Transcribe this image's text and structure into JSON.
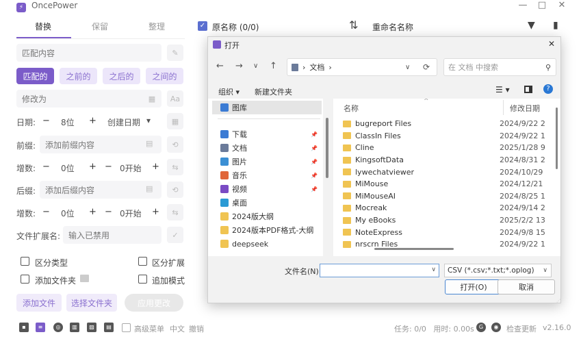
{
  "app": {
    "title": "OncePower",
    "win_min": "—",
    "win_max": "□",
    "win_close": "✕"
  },
  "tabs": [
    {
      "label": "替换"
    },
    {
      "label": "保留"
    },
    {
      "label": "整理"
    }
  ],
  "replace": {
    "match_placeholder": "匹配内容",
    "modes": [
      "匹配的",
      "之前的",
      "之后的",
      "之间的"
    ],
    "change_placeholder": "修改为",
    "aa": "Aa"
  },
  "date_row": {
    "label": "日期:",
    "minus": "−",
    "value": "8位",
    "plus": "+",
    "type": "创建日期",
    "caret": "▾"
  },
  "prefix": {
    "label": "前缀:",
    "placeholder": "添加前缀内容"
  },
  "incr1": {
    "label": "增数:",
    "minus": "−",
    "value": "0位",
    "plus": "+",
    "minus2": "−",
    "start": "0开始",
    "plus2": "+"
  },
  "suffix": {
    "label": "后缀:",
    "placeholder": "添加后缀内容"
  },
  "incr2": {
    "label": "增数:",
    "minus": "−",
    "value": "0位",
    "plus": "+",
    "minus2": "−",
    "start": "0开始",
    "plus2": "+"
  },
  "ext": {
    "label": "文件扩展名:",
    "placeholder": "输入已禁用"
  },
  "options": {
    "case_type": "区分类型",
    "case_ext": "区分扩展",
    "add_folder": "添加文件夹",
    "append_mode": "追加模式"
  },
  "actions": {
    "add_file": "添加文件",
    "select_folder": "选择文件夹",
    "apply": "应用更改"
  },
  "bottom": {
    "advanced": "高级菜单",
    "lang": "中文",
    "undo": "撤销",
    "status": "任务: 0/0   用时: 0.00s",
    "update": "检查更新",
    "version": "v2.16.0"
  },
  "header": {
    "original_name": "原名称 (0/0)",
    "rename_name": "重命名名称"
  },
  "dialog": {
    "title": "打开",
    "close": "✕",
    "path_sep": "›",
    "path": "文档",
    "search_placeholder": "在 文档 中搜索",
    "organize": "组织 ▾",
    "new_folder": "新建文件夹",
    "sidebar": [
      {
        "label": "图库",
        "color": "#3b7bd4",
        "pinned": false,
        "sel": true
      },
      {
        "label": "下载",
        "color": "#3b7bd4",
        "pinned": true
      },
      {
        "label": "文档",
        "color": "#6b7b9a",
        "pinned": true
      },
      {
        "label": "图片",
        "color": "#3b8fd4",
        "pinned": true
      },
      {
        "label": "音乐",
        "color": "#e0663a",
        "pinned": true
      },
      {
        "label": "视频",
        "color": "#7a4bc4",
        "pinned": true
      },
      {
        "label": "桌面",
        "color": "#2a9ad4",
        "pinned": false
      },
      {
        "label": "2024版大纲",
        "color": "#f0c452",
        "pinned": false
      },
      {
        "label": "2024版本PDF格式-大纲",
        "color": "#f0c452",
        "pinned": false
      },
      {
        "label": "deepseek",
        "color": "#f0c452",
        "pinned": false
      }
    ],
    "columns": {
      "name": "名称",
      "modified": "修改日期"
    },
    "files": [
      {
        "name": "bugreport Files",
        "date": "2024/9/22 2"
      },
      {
        "name": "ClassIn Files",
        "date": "2024/9/22 1"
      },
      {
        "name": "Cline",
        "date": "2025/1/28 9"
      },
      {
        "name": "KingsoftData",
        "date": "2024/8/31 2"
      },
      {
        "name": "lywechatviewer",
        "date": "2024/10/29"
      },
      {
        "name": "MiMouse",
        "date": "2024/12/21"
      },
      {
        "name": "MiMouseAI",
        "date": "2024/8/25 1"
      },
      {
        "name": "Mocreak",
        "date": "2024/9/14 2"
      },
      {
        "name": "My eBooks",
        "date": "2025/2/2 13"
      },
      {
        "name": "NoteExpress",
        "date": "2024/9/8 15"
      },
      {
        "name": "nrscrn Files",
        "date": "2024/9/22 1"
      }
    ],
    "filename_label": "文件名(N):",
    "filetype": "CSV (*.csv;*.txt;*.oplog)",
    "open_btn": "打开(O)",
    "cancel_btn": "取消"
  }
}
